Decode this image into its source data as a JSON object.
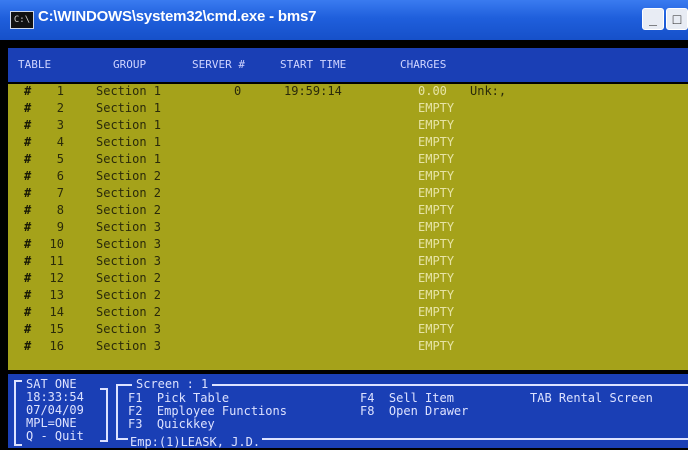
{
  "window": {
    "title": "C:\\WINDOWS\\system32\\cmd.exe - bms7",
    "icon": "console-icon",
    "minimize": "_",
    "maximize": "□"
  },
  "header": {
    "table": "TABLE",
    "group": "GROUP",
    "server": "SERVER #",
    "start_time": "START TIME",
    "charges": "CHARGES"
  },
  "rows": [
    {
      "hash": "#",
      "num": "1",
      "group": "Section 1",
      "server": "0",
      "time": "19:59:14",
      "charges": "0.00",
      "extra": "Unk:,"
    },
    {
      "hash": "#",
      "num": "2",
      "group": "Section 1",
      "server": "",
      "time": "",
      "charges": "EMPTY",
      "extra": ""
    },
    {
      "hash": "#",
      "num": "3",
      "group": "Section 1",
      "server": "",
      "time": "",
      "charges": "EMPTY",
      "extra": ""
    },
    {
      "hash": "#",
      "num": "4",
      "group": "Section 1",
      "server": "",
      "time": "",
      "charges": "EMPTY",
      "extra": ""
    },
    {
      "hash": "#",
      "num": "5",
      "group": "Section 1",
      "server": "",
      "time": "",
      "charges": "EMPTY",
      "extra": ""
    },
    {
      "hash": "#",
      "num": "6",
      "group": "Section 2",
      "server": "",
      "time": "",
      "charges": "EMPTY",
      "extra": ""
    },
    {
      "hash": "#",
      "num": "7",
      "group": "Section 2",
      "server": "",
      "time": "",
      "charges": "EMPTY",
      "extra": ""
    },
    {
      "hash": "#",
      "num": "8",
      "group": "Section 2",
      "server": "",
      "time": "",
      "charges": "EMPTY",
      "extra": ""
    },
    {
      "hash": "#",
      "num": "9",
      "group": "Section 3",
      "server": "",
      "time": "",
      "charges": "EMPTY",
      "extra": ""
    },
    {
      "hash": "#",
      "num": "10",
      "group": "Section 3",
      "server": "",
      "time": "",
      "charges": "EMPTY",
      "extra": ""
    },
    {
      "hash": "#",
      "num": "11",
      "group": "Section 3",
      "server": "",
      "time": "",
      "charges": "EMPTY",
      "extra": ""
    },
    {
      "hash": "#",
      "num": "12",
      "group": "Section 2",
      "server": "",
      "time": "",
      "charges": "EMPTY",
      "extra": ""
    },
    {
      "hash": "#",
      "num": "13",
      "group": "Section 2",
      "server": "",
      "time": "",
      "charges": "EMPTY",
      "extra": ""
    },
    {
      "hash": "#",
      "num": "14",
      "group": "Section 2",
      "server": "",
      "time": "",
      "charges": "EMPTY",
      "extra": ""
    },
    {
      "hash": "#",
      "num": "15",
      "group": "Section 3",
      "server": "",
      "time": "",
      "charges": "EMPTY",
      "extra": ""
    },
    {
      "hash": "#",
      "num": "16",
      "group": "Section 3",
      "server": "",
      "time": "",
      "charges": "EMPTY",
      "extra": ""
    }
  ],
  "status": {
    "day": "SAT ONE",
    "time": "18:33:54",
    "date": "07/04/09",
    "mpl": "MPL=ONE",
    "quit": "Q - Quit"
  },
  "screen": {
    "title": "Screen : 1",
    "f1": "F1  Pick Table",
    "f2": "F2  Employee Functions",
    "f3": "F3  Quickkey",
    "f4": "F4  Sell Item",
    "f8": "F8  Open Drawer",
    "tab": "TAB Rental Screen",
    "employee": "Emp:(1)LEASK, J.D."
  }
}
